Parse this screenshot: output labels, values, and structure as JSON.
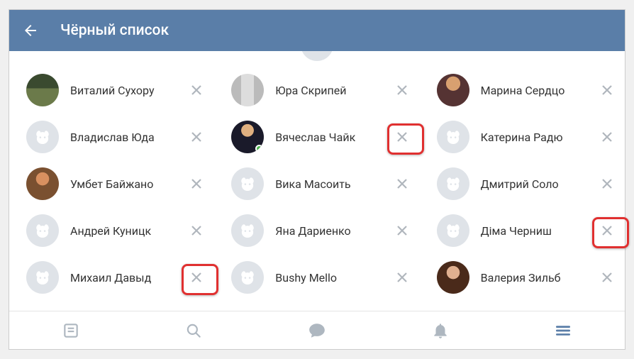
{
  "header": {
    "title": "Чёрный список"
  },
  "users": [
    {
      "name": "Виталий Сухору",
      "avatar": "photo1",
      "online": false,
      "highlight": false
    },
    {
      "name": "Юра Скрипей",
      "avatar": "photo2",
      "online": false,
      "highlight": false
    },
    {
      "name": "Марина Сердцо",
      "avatar": "photo3",
      "online": false,
      "highlight": false
    },
    {
      "name": "Владислав Юда",
      "avatar": "default",
      "online": false,
      "highlight": false
    },
    {
      "name": "Вячеслав Чайк",
      "avatar": "photo4",
      "online": true,
      "highlight": true
    },
    {
      "name": "Катерина Радю",
      "avatar": "default",
      "online": false,
      "highlight": false
    },
    {
      "name": "Умбет Байжано",
      "avatar": "photo5",
      "online": false,
      "highlight": false
    },
    {
      "name": "Вика Масоить",
      "avatar": "default",
      "online": false,
      "highlight": false
    },
    {
      "name": "Дмитрий Соло",
      "avatar": "default",
      "online": false,
      "highlight": false
    },
    {
      "name": "Андрей Куницк",
      "avatar": "default",
      "online": false,
      "highlight": false
    },
    {
      "name": "Яна Дариенко",
      "avatar": "default",
      "online": false,
      "highlight": false
    },
    {
      "name": "Діма Черниш",
      "avatar": "default",
      "online": false,
      "highlight": true
    },
    {
      "name": "Михаил Давыд",
      "avatar": "default",
      "online": false,
      "highlight": true
    },
    {
      "name": "Bushy Mello",
      "avatar": "default",
      "online": false,
      "highlight": false
    },
    {
      "name": "Валерия Зильб",
      "avatar": "photo6",
      "online": false,
      "highlight": false
    }
  ],
  "nav": {
    "items": [
      "news",
      "search",
      "messages",
      "notifications",
      "menu"
    ],
    "active": "menu"
  }
}
